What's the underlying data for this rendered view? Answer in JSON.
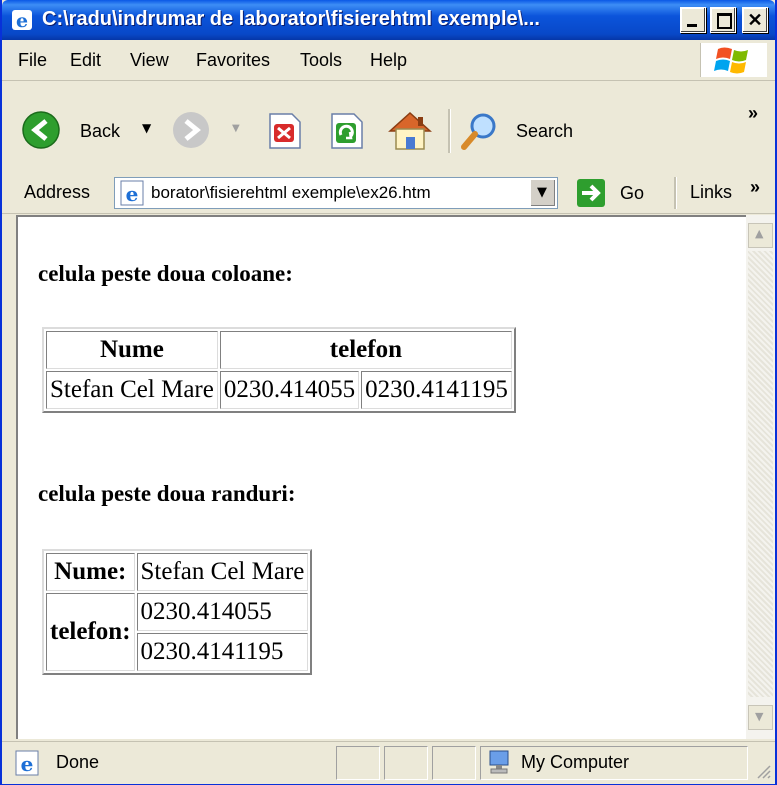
{
  "window": {
    "title": "C:\\radu\\indrumar de laborator\\fisierehtml exemple\\..."
  },
  "menu": {
    "file": "File",
    "edit": "Edit",
    "view": "View",
    "favorites": "Favorites",
    "tools": "Tools",
    "help": "Help"
  },
  "toolbar": {
    "back_label": "Back",
    "search_label": "Search"
  },
  "address": {
    "label": "Address",
    "value": "borator\\fisierehtml exemple\\ex26.htm",
    "go_label": "Go",
    "links_label": "Links"
  },
  "page": {
    "heading1": "celula peste doua coloane:",
    "table1": {
      "header_nume": "Nume",
      "header_telefon": "telefon",
      "name": "Stefan Cel Mare",
      "phone1": "0230.414055",
      "phone2": "0230.4141195"
    },
    "heading2": "celula peste doua randuri:",
    "table2": {
      "label_nume": "Nume:",
      "name": "Stefan Cel Mare",
      "label_telefon": "telefon:",
      "phone1": "0230.414055",
      "phone2": "0230.4141195"
    }
  },
  "status": {
    "text": "Done",
    "zone": "My Computer"
  },
  "colors": {
    "titlebar": "#0a58e6",
    "chrome": "#ece9d8",
    "go_green": "#2e9e2e"
  }
}
